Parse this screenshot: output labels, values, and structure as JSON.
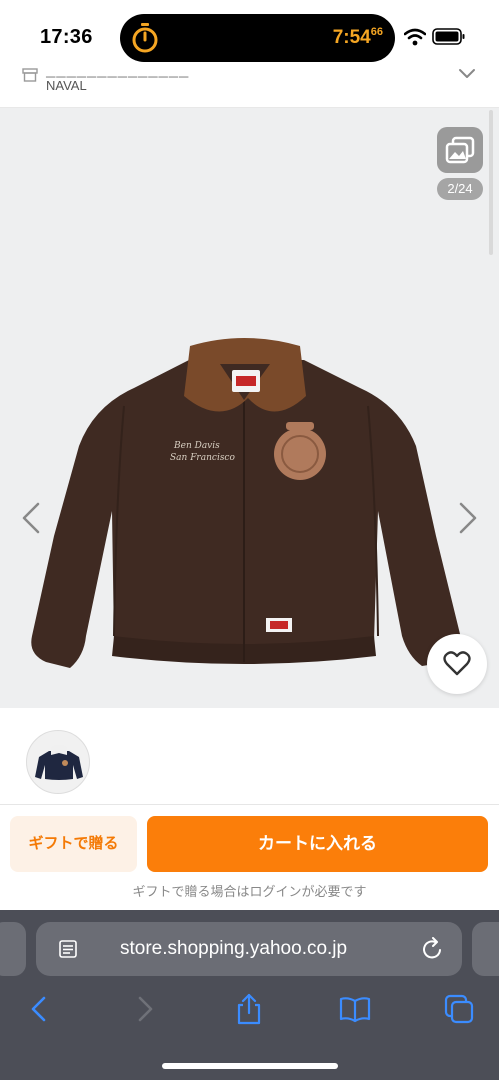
{
  "status_bar": {
    "time": "17:36",
    "timer_value": "7:54",
    "timer_fraction": "66",
    "accent_color": "#f5a623"
  },
  "store_header": {
    "store_name": "NAVAL",
    "icon": "store-icon",
    "expand_icon": "chevron-down-icon"
  },
  "gallery": {
    "counter": "2/24",
    "current_image": 2,
    "total_images": 24,
    "icons": [
      "gallery-icon",
      "chevron-left-icon",
      "chevron-right-icon",
      "heart-icon"
    ]
  },
  "actions": {
    "gift_label": "ギフトで贈る",
    "cart_label": "カートに入れる",
    "gift_note": "ギフトで贈る場合はログインが必要です",
    "accent_color": "#fb7e0a"
  },
  "browser": {
    "url": "store.shopping.yahoo.co.jp",
    "icons": [
      "reader-icon",
      "reload-icon",
      "back-icon",
      "forward-icon",
      "share-icon",
      "bookmarks-icon",
      "tabs-icon"
    ]
  }
}
